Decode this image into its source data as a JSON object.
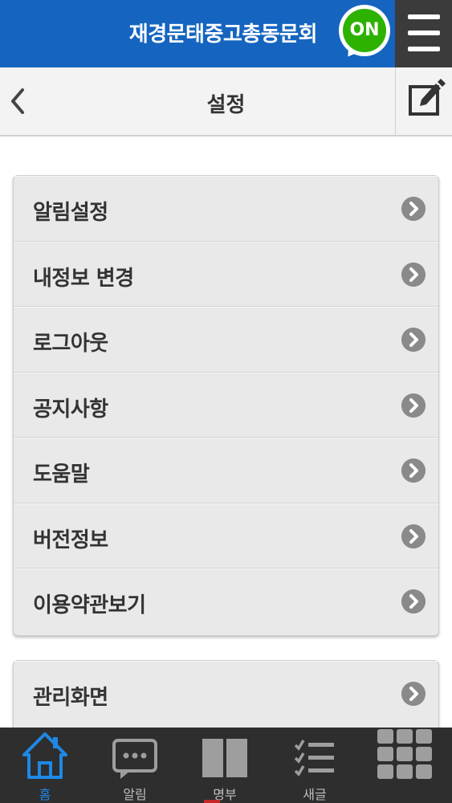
{
  "app": {
    "title": "재경문태중고총동문회",
    "badge": "ON",
    "colors": {
      "brand_blue": "#1565c0",
      "badge_green": "#2db200",
      "nav_active": "#1e88e5"
    }
  },
  "header": {
    "title": "설정",
    "back_icon": "chevron-left-icon",
    "edit_icon": "edit-icon"
  },
  "settings": {
    "group1": [
      {
        "label": "알림설정"
      },
      {
        "label": "내정보 변경"
      },
      {
        "label": "로그아웃"
      },
      {
        "label": "공지사항"
      },
      {
        "label": "도움말"
      },
      {
        "label": "버전정보"
      },
      {
        "label": "이용약관보기"
      }
    ],
    "group2": [
      {
        "label": "관리화면"
      }
    ]
  },
  "bottom_nav": {
    "items": [
      {
        "label": "홈",
        "icon": "home-icon",
        "active": true
      },
      {
        "label": "알림",
        "icon": "chat-bubble-icon",
        "active": false
      },
      {
        "label": "명부",
        "icon": "book-icon",
        "active": false
      },
      {
        "label": "새글",
        "icon": "checklist-icon",
        "active": false
      },
      {
        "label": "",
        "icon": "grid-icon",
        "active": false
      }
    ]
  }
}
